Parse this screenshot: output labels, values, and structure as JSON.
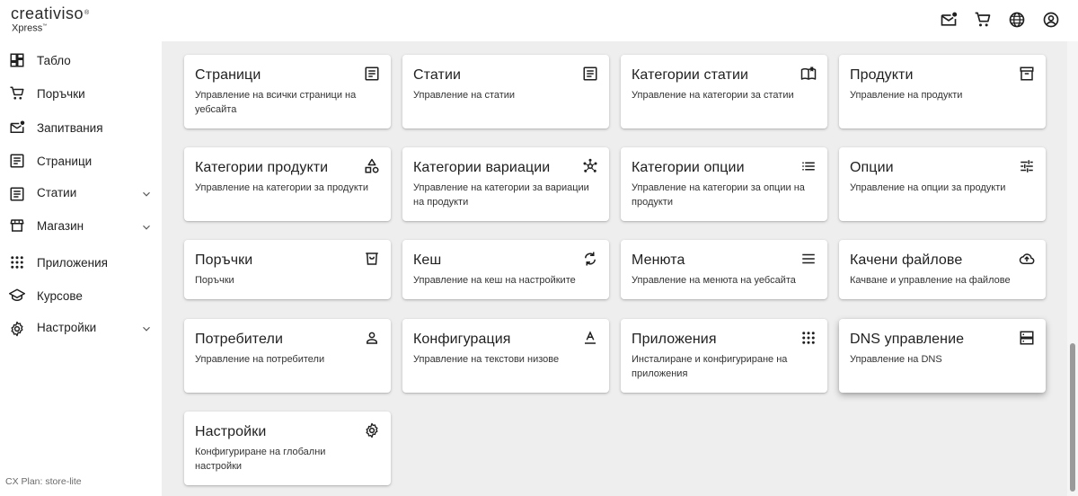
{
  "brand": {
    "name": "creativiso",
    "registered": "®",
    "sub": "Xpress",
    "tm": "™"
  },
  "topbar": {
    "icons": [
      "mail-notification-icon",
      "cart-icon",
      "globe-icon",
      "account-icon"
    ]
  },
  "sidebar": {
    "items": [
      {
        "label": "Табло",
        "icon": "dashboard-icon",
        "expandable": false
      },
      {
        "label": "Поръчки",
        "icon": "cart-icon",
        "expandable": false
      },
      {
        "label": "Запитвания",
        "icon": "mail-notification-icon",
        "expandable": false
      },
      {
        "label": "Страници",
        "icon": "page-icon",
        "expandable": false
      },
      {
        "label": "Статии",
        "icon": "article-icon",
        "expandable": true
      },
      {
        "label": "Магазин",
        "icon": "store-icon",
        "expandable": true
      },
      {
        "label": "Приложения",
        "icon": "apps-grid-icon",
        "expandable": false
      },
      {
        "label": "Курсове",
        "icon": "school-icon",
        "expandable": false
      },
      {
        "label": "Настройки",
        "icon": "settings-icon",
        "expandable": true
      }
    ],
    "plan": "CX Plan: store-lite"
  },
  "cards": [
    {
      "title": "Страници",
      "desc": "Управление на всички страници на уебсайта",
      "icon": "page-icon"
    },
    {
      "title": "Статии",
      "desc": "Управление на статии",
      "icon": "article-icon"
    },
    {
      "title": "Категории статии",
      "desc": "Управление на категории за статии",
      "icon": "book-icon"
    },
    {
      "title": "Продукти",
      "desc": "Управление на продукти",
      "icon": "inventory-box-icon"
    },
    {
      "title": "Категории продукти",
      "desc": "Управление на категории за продукти",
      "icon": "category-shapes-icon"
    },
    {
      "title": "Категории вариации",
      "desc": "Управление на категории за вариации на продукти",
      "icon": "hub-icon"
    },
    {
      "title": "Категории опции",
      "desc": "Управление на категории за опции на продукти",
      "icon": "list-icon"
    },
    {
      "title": "Опции",
      "desc": "Управление на опции за продукти",
      "icon": "tune-icon"
    },
    {
      "title": "Поръчки",
      "desc": "Поръчки",
      "icon": "shopping-basket-icon"
    },
    {
      "title": "Кеш",
      "desc": "Управление на кеш на настройките",
      "icon": "refresh-icon"
    },
    {
      "title": "Менюта",
      "desc": "Управление на менюта на уебсайта",
      "icon": "menu-icon"
    },
    {
      "title": "Качени файлове",
      "desc": "Качване и управление на файлове",
      "icon": "cloud-upload-icon"
    },
    {
      "title": "Потребители",
      "desc": "Управление на потребители",
      "icon": "person-icon"
    },
    {
      "title": "Конфигурация",
      "desc": "Управление на текстови низове",
      "icon": "text-format-icon"
    },
    {
      "title": "Приложения",
      "desc": "Инсталиране и конфигуриране на приложения",
      "icon": "apps-grid-icon"
    },
    {
      "title": "DNS управление",
      "desc": "Управление на DNS",
      "icon": "dns-icon"
    },
    {
      "title": "Настройки",
      "desc": "Конфигуриране на глобални настройки",
      "icon": "settings-icon"
    }
  ],
  "colors": {
    "main_bg": "#eeeeee",
    "card_bg": "#ffffff",
    "text": "#1f1f1f"
  }
}
